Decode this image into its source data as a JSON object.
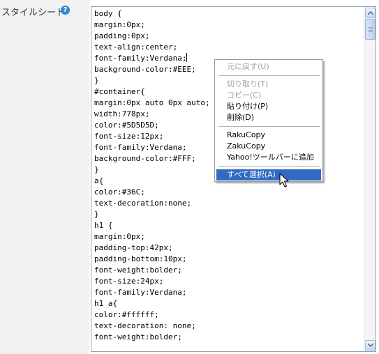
{
  "field": {
    "label": "スタイルシート",
    "help_icon": "?"
  },
  "editor": {
    "lines": [
      "body {",
      "margin:0px;",
      "padding:0px;",
      "text-align:center;",
      "font-family:Verdana;",
      "background-color:#EEE;",
      "}",
      "#container{",
      "margin:0px auto 0px auto;",
      "width:778px;",
      "color:#5D5D5D;",
      "font-size:12px;",
      "font-family:Verdana;",
      "background-color:#FFF;",
      "}",
      "a{",
      "color:#36C;",
      "text-decoration:none;",
      "}",
      "h1 {",
      "margin:0px;",
      "padding-top:42px;",
      "padding-bottom:10px;",
      "font-weight:bolder;",
      "font-size:24px;",
      "font-family:Verdana;",
      "h1 a{",
      "color:#ffffff;",
      "text-decoration: none;",
      "font-weight:bolder;"
    ]
  },
  "context_menu": {
    "items": [
      {
        "label": "元に戻す(U)",
        "disabled": true
      },
      {
        "label": "切り取り(T)",
        "disabled": true
      },
      {
        "label": "コピー(C)",
        "disabled": true
      },
      {
        "label": "貼り付け(P)",
        "disabled": false
      },
      {
        "label": "削除(D)",
        "disabled": false
      },
      {
        "label": "RakuCopy",
        "disabled": false
      },
      {
        "label": "ZakuCopy",
        "disabled": false
      },
      {
        "label": "Yahoo!ツールバーに追加",
        "disabled": false
      },
      {
        "label": "すべて選択(A)",
        "disabled": false,
        "selected": true
      }
    ]
  },
  "colors": {
    "selection": "#316ac5",
    "help_icon": "#2f86d6",
    "editor_border": "#8ea2b9"
  }
}
